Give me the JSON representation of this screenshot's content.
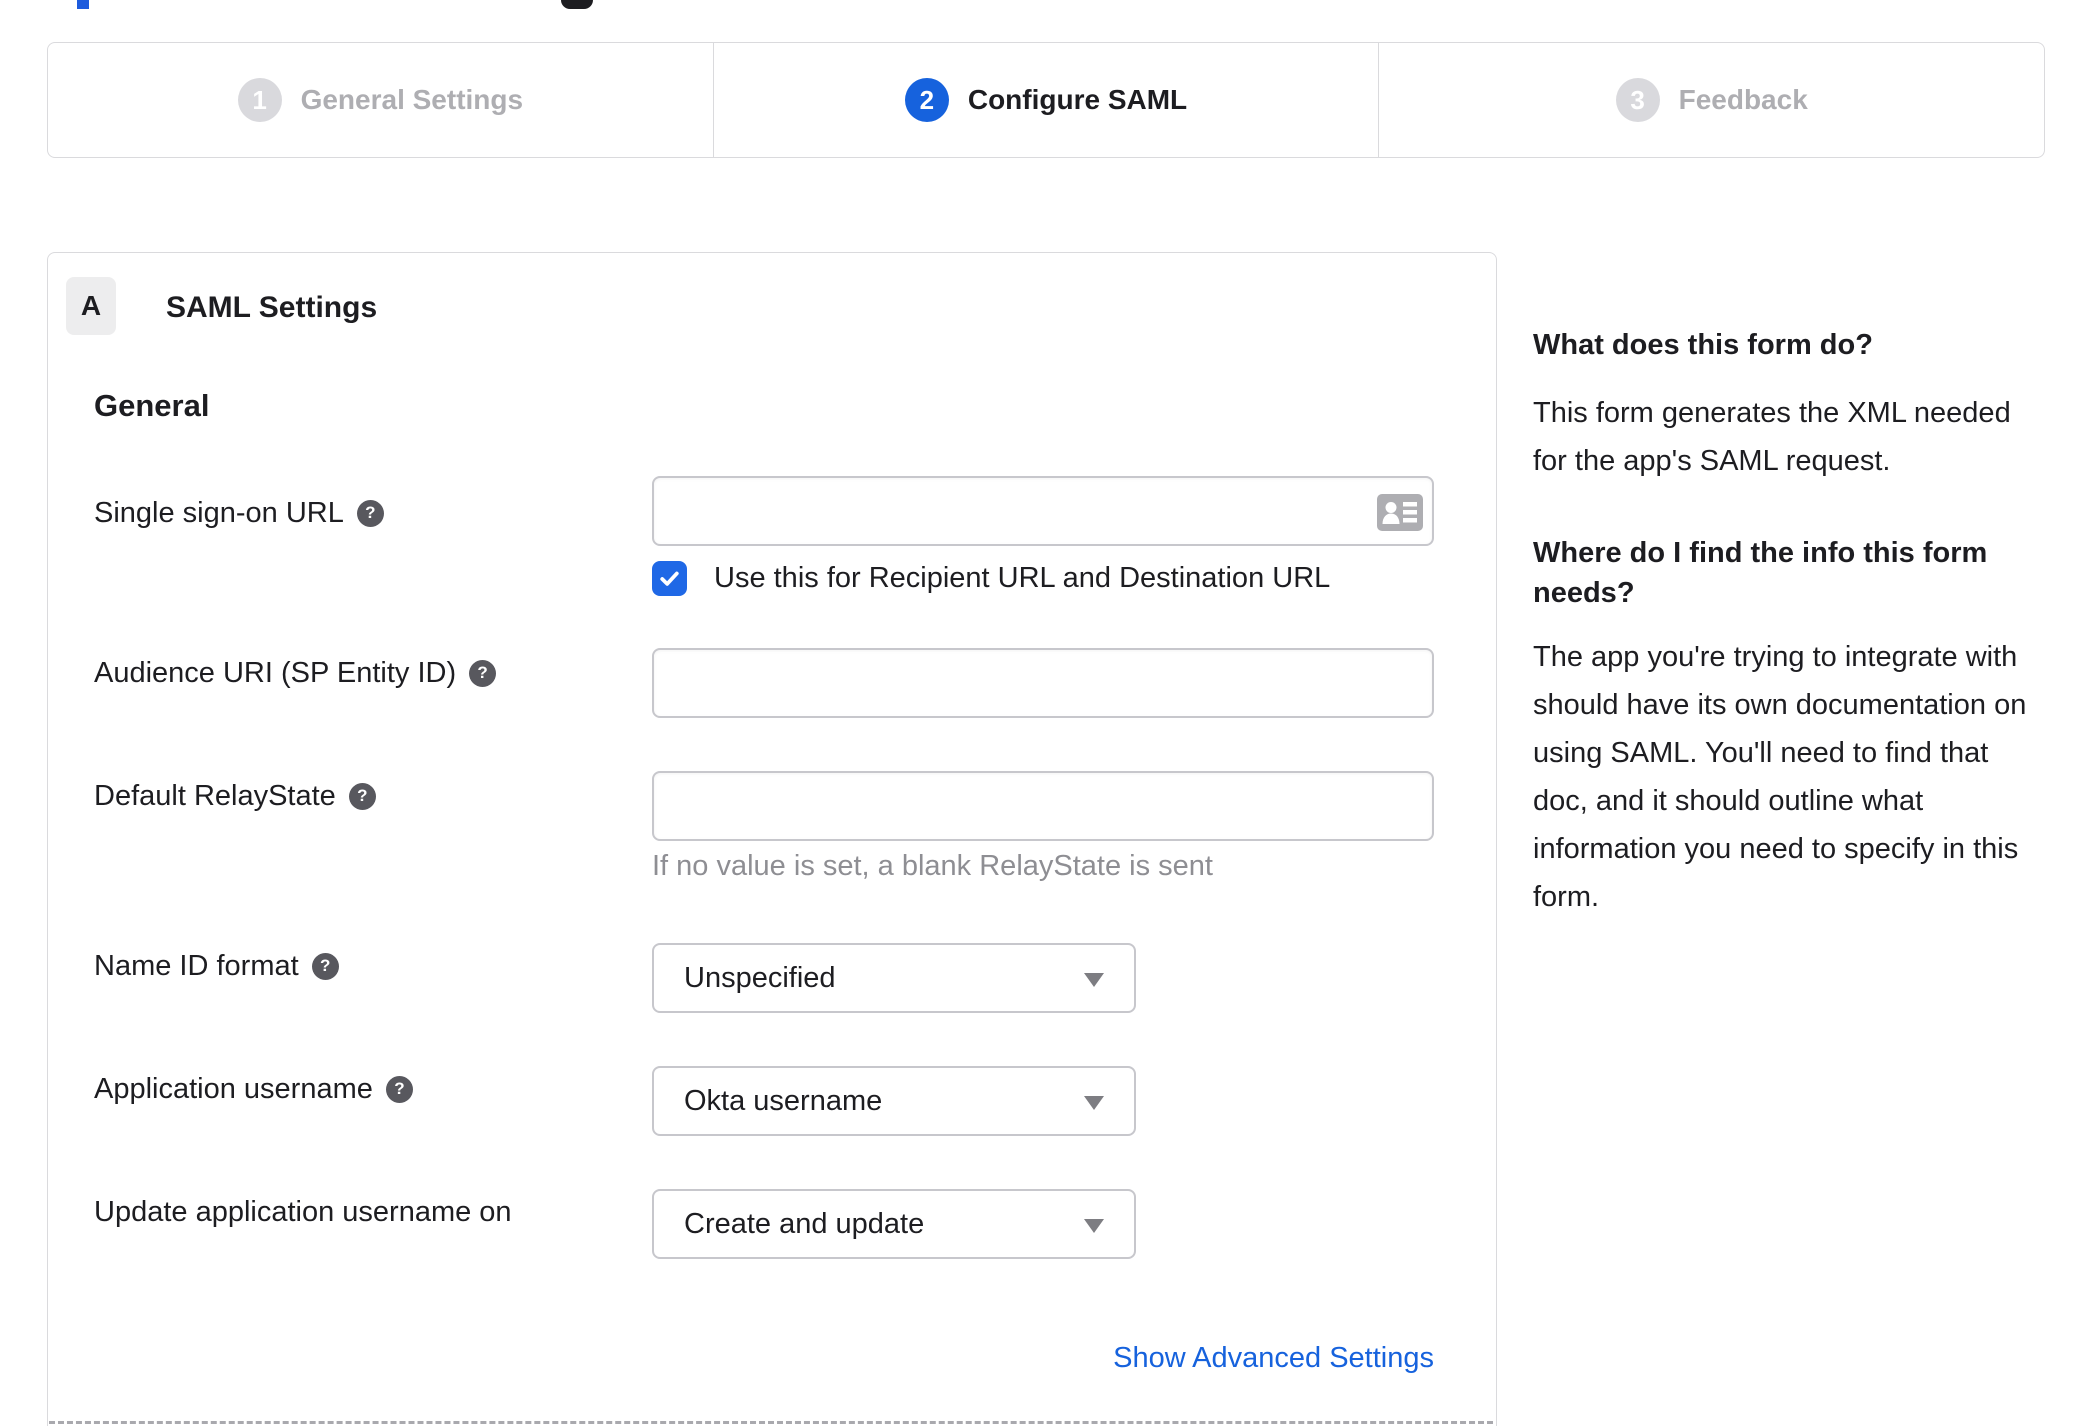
{
  "stepper": {
    "steps": [
      {
        "number": "1",
        "label": "General Settings",
        "state": "inactive"
      },
      {
        "number": "2",
        "label": "Configure SAML",
        "state": "active"
      },
      {
        "number": "3",
        "label": "Feedback",
        "state": "inactive"
      }
    ]
  },
  "panel": {
    "section_badge": "A",
    "section_title": "SAML Settings",
    "group_heading": "General",
    "fields": [
      {
        "label": "Single sign-on URL",
        "has_help": true,
        "type": "text",
        "value": ""
      },
      {
        "label": "Audience URI (SP Entity ID)",
        "has_help": true,
        "type": "text",
        "value": ""
      },
      {
        "label": "Default RelayState",
        "has_help": true,
        "type": "text",
        "value": "",
        "hint": "If no value is set, a blank RelayState is sent"
      },
      {
        "label": "Name ID format",
        "has_help": true,
        "type": "select",
        "value": "Unspecified"
      },
      {
        "label": "Application username",
        "has_help": true,
        "type": "select",
        "value": "Okta username"
      },
      {
        "label": "Update application username on",
        "has_help": false,
        "type": "select",
        "value": "Create and update"
      }
    ],
    "sso_checkbox": {
      "checked": true,
      "label": "Use this for Recipient URL and Destination URL"
    },
    "advanced_link": "Show Advanced Settings"
  },
  "sidebar": {
    "blocks": [
      {
        "heading": "What does this form do?",
        "body": "This form generates the XML needed for the app's SAML request."
      },
      {
        "heading": "Where do I find the info this form needs?",
        "body": "The app you're trying to integrate with should have its own documentation on using SAML. You'll need to find that doc, and it should outline what information you need to specify in this form."
      }
    ]
  },
  "icons": {
    "help_glyph": "?",
    "contact_card_icon": "contact-card-icon",
    "caret_down_icon": "caret-down-icon",
    "checkmark_icon": "checkmark-icon"
  },
  "colors": {
    "accent_blue": "#1662dd",
    "checkbox_blue": "#1f68e6",
    "link_blue": "#1662dd",
    "inactive_gray": "#aeaeb2",
    "border_gray": "#c7c7cc",
    "text": "#1d1d21",
    "hint_gray": "#8e8e93"
  }
}
